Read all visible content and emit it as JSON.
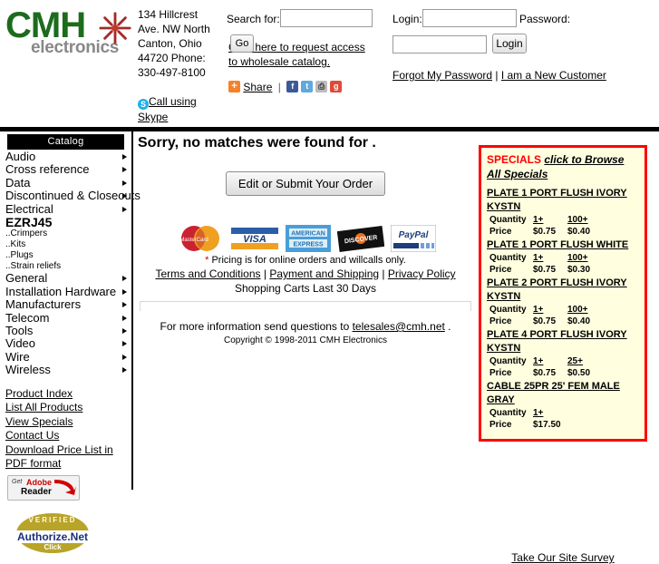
{
  "header": {
    "logo": {
      "brand": "CMH",
      "sub": "electronics",
      "star_icon": "starburst-icon"
    },
    "address": "134 Hillcrest Ave. NW North Canton, Ohio 44720 Phone: 330-497-8100",
    "skype_label": "Call using Skype",
    "search_label": "Search for:",
    "search_value": "",
    "go_label": "Go",
    "wholesale_link": "Click here to request access to wholesale catalog.",
    "share_label": "Share",
    "login_label": "Login:",
    "login_value": "",
    "password_label": "Password:",
    "password_value": "",
    "login_button": "Login",
    "forgot_link": "Forgot My Password",
    "newcust_link": "I am a New Customer",
    "link_sep": " | "
  },
  "sidebar": {
    "catalog_header": "Catalog",
    "items": [
      {
        "label": "Audio",
        "arrow": true,
        "bold": false,
        "sub": false
      },
      {
        "label": "Cross reference",
        "arrow": true,
        "bold": false,
        "sub": false
      },
      {
        "label": "Data",
        "arrow": true,
        "bold": false,
        "sub": false
      },
      {
        "label": "Discontinued & Closeouts",
        "arrow": true,
        "bold": false,
        "sub": false
      },
      {
        "label": "Electrical",
        "arrow": true,
        "bold": false,
        "sub": false
      },
      {
        "label": "EZRJ45",
        "arrow": false,
        "bold": true,
        "sub": false
      },
      {
        "label": "..Crimpers",
        "arrow": false,
        "bold": false,
        "sub": true
      },
      {
        "label": "..Kits",
        "arrow": false,
        "bold": false,
        "sub": true
      },
      {
        "label": "..Plugs",
        "arrow": false,
        "bold": false,
        "sub": true
      },
      {
        "label": "..Strain reliefs",
        "arrow": false,
        "bold": false,
        "sub": true
      },
      {
        "label": "General",
        "arrow": true,
        "bold": false,
        "sub": false
      },
      {
        "label": "Installation Hardware",
        "arrow": true,
        "bold": false,
        "sub": false
      },
      {
        "label": "Manufacturers",
        "arrow": true,
        "bold": false,
        "sub": false
      },
      {
        "label": "Telecom",
        "arrow": true,
        "bold": false,
        "sub": false
      },
      {
        "label": "Tools",
        "arrow": true,
        "bold": false,
        "sub": false
      },
      {
        "label": "Video",
        "arrow": true,
        "bold": false,
        "sub": false
      },
      {
        "label": "Wire",
        "arrow": true,
        "bold": false,
        "sub": false
      },
      {
        "label": "Wireless",
        "arrow": true,
        "bold": false,
        "sub": false
      }
    ],
    "links": [
      "Product Index",
      "List All Products",
      "View Specials",
      "Contact Us",
      "Download Price List in PDF format"
    ],
    "adobe_badge": {
      "get": "Get",
      "adobe": "Adobe",
      "reader": "Reader"
    },
    "authorize_badge": {
      "verified": "VERIFIED",
      "name": "Authorize.Net",
      "click": "Click"
    }
  },
  "main": {
    "no_match_message": "Sorry, no matches were found for .",
    "edit_order_button": "Edit or Submit Your Order",
    "cards": [
      "MasterCard",
      "VISA",
      "AMERICAN EXPRESS",
      "DISCOVER",
      "PayPal"
    ],
    "pricing_note": "Pricing is for online orders and willcalls only.",
    "pricing_star": "*",
    "policy_links": [
      "Terms and Conditions",
      "Payment and Shipping",
      "Privacy Policy"
    ],
    "policy_sep": " | ",
    "carts_note": "Shopping Carts Last 30 Days",
    "more_info_prefix": "For more information send questions to ",
    "more_info_email": "telesales@cmh.net",
    "more_info_suffix": " .",
    "copyright": "Copyright © 1998-2011 CMH Electronics"
  },
  "specials": {
    "title_red": "SPECIALS",
    "title_link": "click to Browse All Specials",
    "quantity_label": "Quantity",
    "price_label": "Price",
    "items": [
      {
        "name": "PLATE 1 PORT FLUSH IVORY KYSTN",
        "tier1": "1+",
        "tier2": "100+",
        "price1": "$0.75",
        "price2": "$0.40"
      },
      {
        "name": "PLATE 1 PORT FLUSH WHITE",
        "tier1": "1+",
        "tier2": "100+",
        "price1": "$0.75",
        "price2": "$0.30"
      },
      {
        "name": "PLATE 2 PORT FLUSH IVORY KYSTN",
        "tier1": "1+",
        "tier2": "100+",
        "price1": "$0.75",
        "price2": "$0.40"
      },
      {
        "name": "PLATE 4 PORT FLUSH IVORY KYSTN",
        "tier1": "1+",
        "tier2": "25+",
        "price1": "$0.75",
        "price2": "$0.50"
      },
      {
        "name": "CABLE 25PR 25' FEM MALE GRAY",
        "tier1": "1+",
        "tier2": "",
        "price1": "$17.50",
        "price2": ""
      }
    ],
    "survey_link": "Take Our Site Survey"
  },
  "colors": {
    "accent_red": "#ff0000",
    "specials_bg": "#ffffe0",
    "brand_green": "#1d6b1d",
    "brand_gray": "#888888"
  }
}
